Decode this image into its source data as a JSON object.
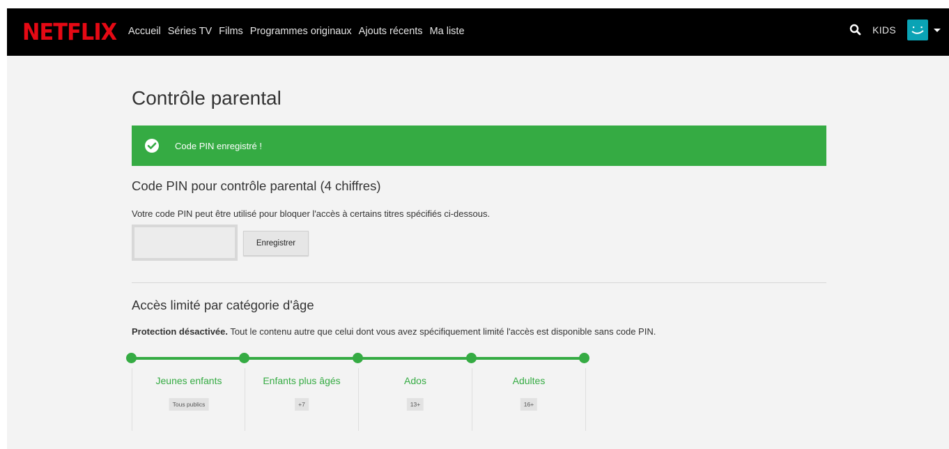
{
  "header": {
    "logo": "NETFLIX",
    "nav": [
      "Accueil",
      "Séries TV",
      "Films",
      "Programmes originaux",
      "Ajouts récents",
      "Ma liste"
    ],
    "kids_label": "KIDS",
    "search_icon": "search-icon",
    "avatar_color": "#0aa3b5"
  },
  "page": {
    "title": "Contrôle parental",
    "banner": {
      "text": "Code PIN enregistré !",
      "color": "#35ab43",
      "icon": "check-circle-icon"
    },
    "pin_section": {
      "title": "Code PIN pour contrôle parental (4 chiffres)",
      "description": "Votre code PIN peut être utilisé pour bloquer l'accès à certains titres spécifiés ci-dessous.",
      "input_value": "",
      "save_label": "Enregistrer"
    },
    "age_section": {
      "title": "Accès limité par catégorie d'âge",
      "status_bold": "Protection désactivée.",
      "status_rest": " Tout le contenu autre que celui dont vous avez spécifiquement limité l'accès est disponible sans code PIN.",
      "accent_color": "#35ab43",
      "categories": [
        {
          "name": "Jeunes enfants",
          "rating": "Tous publics"
        },
        {
          "name": "Enfants plus âgés",
          "rating": "+7"
        },
        {
          "name": "Ados",
          "rating": "13+"
        },
        {
          "name": "Adultes",
          "rating": "16+"
        }
      ]
    }
  }
}
